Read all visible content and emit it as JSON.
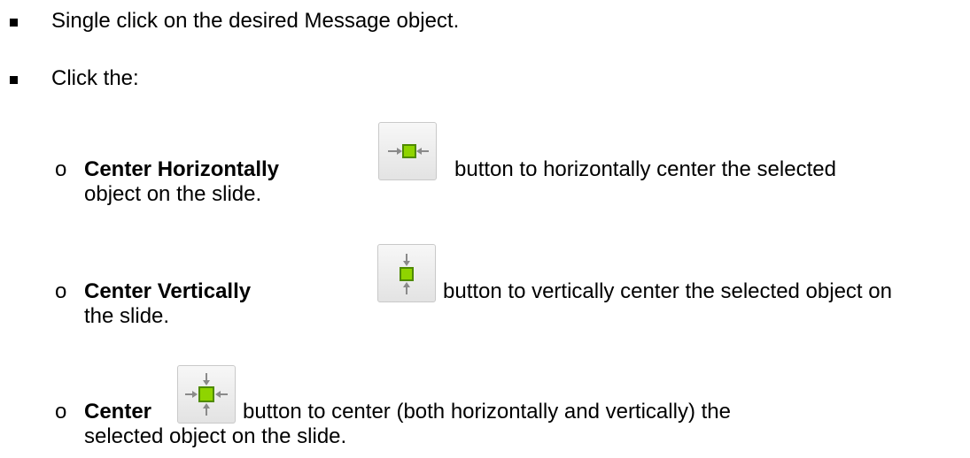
{
  "steps": [
    {
      "text": "Single click on the desired Message object."
    },
    {
      "text": "Click the:"
    }
  ],
  "sub_bullet_marker": "o",
  "options": [
    {
      "name": "Center Horizontally",
      "icon": "center-horizontally-icon",
      "line1": "button to horizontally center the selected",
      "line2": "object on the slide."
    },
    {
      "name": "Center Vertically",
      "icon": "center-vertically-icon",
      "line1": "button to vertically center the selected object on",
      "line2": "the slide."
    },
    {
      "name": "Center",
      "icon": "center-icon",
      "line1": "button to center (both horizontally and vertically) the",
      "line2": "selected object on the slide."
    }
  ],
  "colors": {
    "icon_green": "#8fd400",
    "icon_green_border": "#4f8a00",
    "arrow_gray": "#8a8a8a"
  }
}
